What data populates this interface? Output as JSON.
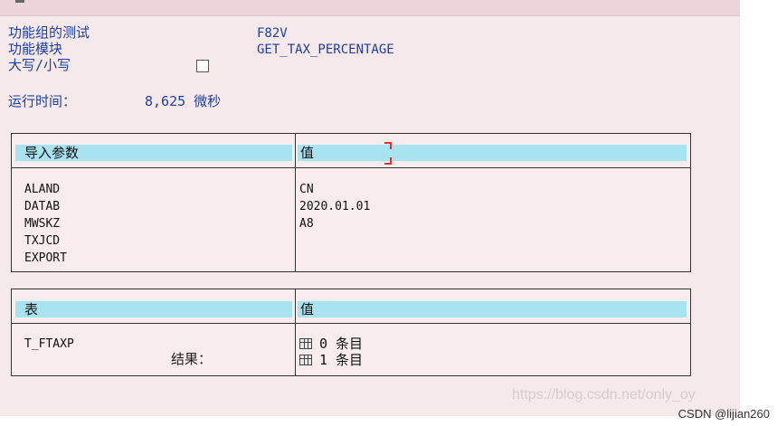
{
  "header": {
    "function_group_label": "功能组的测试",
    "function_group_value": "F82V",
    "function_module_label": "功能模块",
    "function_module_value": "GET_TAX_PERCENTAGE",
    "case_label": "大写/小写",
    "runtime_label": "运行时间：",
    "runtime_value": "8,625 微秒"
  },
  "import_table": {
    "col1_header": "导入参数",
    "col2_header": "值",
    "rows": [
      {
        "param": "ALAND",
        "value": "CN"
      },
      {
        "param": "DATAB",
        "value": "2020.01.01"
      },
      {
        "param": "MWSKZ",
        "value": "A8"
      },
      {
        "param": "TXJCD",
        "value": ""
      },
      {
        "param": "EXPORT",
        "value": ""
      }
    ]
  },
  "tables_table": {
    "col1_header": "表",
    "col2_header": "值",
    "rows": [
      {
        "name": "T_FTAXP",
        "count": "0 条目"
      },
      {
        "name": "",
        "count": "1 条目"
      }
    ],
    "result_label": "结果："
  },
  "watermark": "https://blog.csdn.net/only_oy",
  "credit": "CSDN @lijian260"
}
